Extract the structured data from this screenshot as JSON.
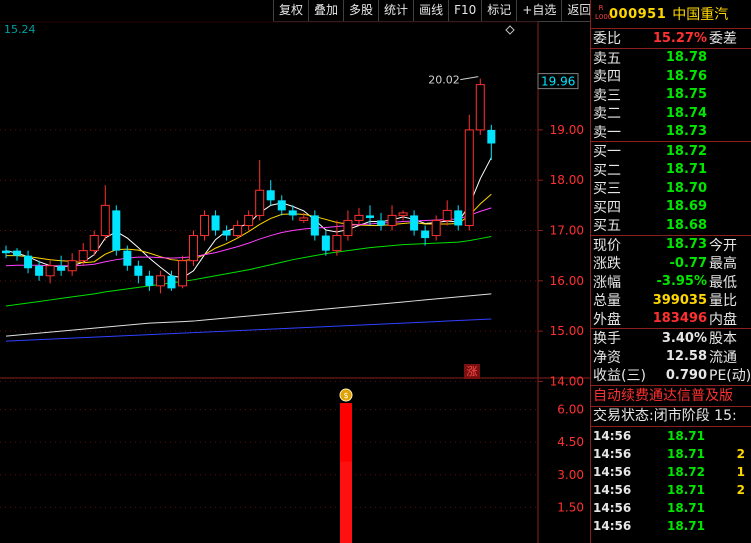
{
  "toolbar": {
    "buttons": [
      "复权",
      "叠加",
      "多股",
      "统计",
      "画线",
      "F10",
      "标记",
      "+自选",
      "返回"
    ]
  },
  "chart": {
    "top_left_value": "15.24",
    "current_price_label": "19.96",
    "high_annotation": "20.02",
    "price_axis_ticks": [
      "19.00",
      "18.00",
      "17.00",
      "16.00",
      "15.00",
      "14.00"
    ],
    "volume_axis_ticks": [
      "6.00",
      "4.50",
      "3.00",
      "1.50"
    ],
    "event_badge": "涨",
    "money_icon": "money-bag-icon"
  },
  "quote": {
    "r_badge": "R\nL000",
    "code": "000951",
    "name": "中国重汽",
    "weibi_label": "委比",
    "weibi_value": "15.27%",
    "weicha_label": "委差",
    "sell": [
      {
        "label": "卖五",
        "price": "18.78"
      },
      {
        "label": "卖四",
        "price": "18.76"
      },
      {
        "label": "卖三",
        "price": "18.75"
      },
      {
        "label": "卖二",
        "price": "18.74"
      },
      {
        "label": "卖一",
        "price": "18.73"
      }
    ],
    "buy": [
      {
        "label": "买一",
        "price": "18.72"
      },
      {
        "label": "买二",
        "price": "18.71"
      },
      {
        "label": "买三",
        "price": "18.70"
      },
      {
        "label": "买四",
        "price": "18.69"
      },
      {
        "label": "买五",
        "price": "18.68"
      }
    ],
    "stats": [
      {
        "label": "现价",
        "value": "18.73",
        "extra": "今开"
      },
      {
        "label": "涨跌",
        "value": "-0.77",
        "extra": "最高"
      },
      {
        "label": "涨幅",
        "value": "-3.95%",
        "extra": "最低"
      },
      {
        "label": "总量",
        "value": "399035",
        "extra": "量比"
      },
      {
        "label": "外盘",
        "value": "183496",
        "extra": "内盘"
      }
    ],
    "stats2": [
      {
        "label": "换手",
        "value": "3.40%",
        "extra": "股本"
      },
      {
        "label": "净资",
        "value": "12.58",
        "extra": "流通"
      },
      {
        "label": "收益(三)",
        "value": "0.790",
        "extra": "PE(动)"
      }
    ],
    "ticker_text": "自动续费通达信普及版",
    "status_text": "交易状态:闭市阶段 15:",
    "trades": [
      {
        "time": "14:56",
        "price": "18.71",
        "vol": ""
      },
      {
        "time": "14:56",
        "price": "18.71",
        "vol": "2"
      },
      {
        "time": "14:56",
        "price": "18.72",
        "vol": "1"
      },
      {
        "time": "14:56",
        "price": "18.71",
        "vol": "2"
      },
      {
        "time": "14:56",
        "price": "18.71",
        "vol": ""
      },
      {
        "time": "14:56",
        "price": "18.71",
        "vol": ""
      }
    ]
  },
  "colors": {
    "up": "#ff3030",
    "down": "#00e5ff",
    "sell_green": "#00e600",
    "gold": "#ffd700",
    "border": "#8a1f1f"
  },
  "chart_data": {
    "type": "candlestick",
    "candles": [
      {
        "o": 16.6,
        "c": 16.55,
        "h": 16.7,
        "l": 16.45
      },
      {
        "o": 16.6,
        "c": 16.5,
        "h": 16.65,
        "l": 16.4
      },
      {
        "o": 16.5,
        "c": 16.25,
        "h": 16.6,
        "l": 16.15
      },
      {
        "o": 16.3,
        "c": 16.1,
        "h": 16.4,
        "l": 16.0
      },
      {
        "o": 16.1,
        "c": 16.3,
        "h": 16.4,
        "l": 15.95
      },
      {
        "o": 16.3,
        "c": 16.2,
        "h": 16.5,
        "l": 16.1
      },
      {
        "o": 16.2,
        "c": 16.4,
        "h": 16.55,
        "l": 16.1
      },
      {
        "o": 16.4,
        "c": 16.6,
        "h": 16.75,
        "l": 16.3
      },
      {
        "o": 16.6,
        "c": 16.9,
        "h": 17.0,
        "l": 16.5
      },
      {
        "o": 16.9,
        "c": 17.5,
        "h": 17.9,
        "l": 16.8
      },
      {
        "o": 17.4,
        "c": 16.6,
        "h": 17.5,
        "l": 16.5
      },
      {
        "o": 16.6,
        "c": 16.3,
        "h": 16.7,
        "l": 16.2
      },
      {
        "o": 16.3,
        "c": 16.1,
        "h": 16.4,
        "l": 15.95
      },
      {
        "o": 16.1,
        "c": 15.9,
        "h": 16.2,
        "l": 15.8
      },
      {
        "o": 15.9,
        "c": 16.1,
        "h": 16.2,
        "l": 15.75
      },
      {
        "o": 16.1,
        "c": 15.85,
        "h": 16.2,
        "l": 15.8
      },
      {
        "o": 15.9,
        "c": 16.4,
        "h": 16.5,
        "l": 15.85
      },
      {
        "o": 16.4,
        "c": 16.9,
        "h": 17.0,
        "l": 16.3
      },
      {
        "o": 16.9,
        "c": 17.3,
        "h": 17.4,
        "l": 16.8
      },
      {
        "o": 17.3,
        "c": 17.0,
        "h": 17.4,
        "l": 16.9
      },
      {
        "o": 17.0,
        "c": 16.9,
        "h": 17.1,
        "l": 16.8
      },
      {
        "o": 16.9,
        "c": 17.1,
        "h": 17.2,
        "l": 16.85
      },
      {
        "o": 17.1,
        "c": 17.3,
        "h": 17.4,
        "l": 17.0
      },
      {
        "o": 17.3,
        "c": 17.8,
        "h": 18.4,
        "l": 17.2
      },
      {
        "o": 17.8,
        "c": 17.6,
        "h": 18.0,
        "l": 17.5
      },
      {
        "o": 17.6,
        "c": 17.4,
        "h": 17.7,
        "l": 17.3
      },
      {
        "o": 17.4,
        "c": 17.3,
        "h": 17.5,
        "l": 17.2
      },
      {
        "o": 17.2,
        "c": 17.25,
        "h": 17.35,
        "l": 17.15
      },
      {
        "o": 17.3,
        "c": 16.9,
        "h": 17.4,
        "l": 16.8
      },
      {
        "o": 16.9,
        "c": 16.6,
        "h": 17.0,
        "l": 16.5
      },
      {
        "o": 16.6,
        "c": 16.9,
        "h": 17.2,
        "l": 16.5
      },
      {
        "o": 16.9,
        "c": 17.2,
        "h": 17.4,
        "l": 16.8
      },
      {
        "o": 17.2,
        "c": 17.3,
        "h": 17.45,
        "l": 17.1
      },
      {
        "o": 17.3,
        "c": 17.25,
        "h": 17.5,
        "l": 17.1
      },
      {
        "o": 17.2,
        "c": 17.1,
        "h": 17.35,
        "l": 17.0
      },
      {
        "o": 17.1,
        "c": 17.3,
        "h": 17.5,
        "l": 17.0
      },
      {
        "o": 17.3,
        "c": 17.35,
        "h": 17.4,
        "l": 17.2
      },
      {
        "o": 17.3,
        "c": 17.0,
        "h": 17.4,
        "l": 16.9
      },
      {
        "o": 17.0,
        "c": 16.85,
        "h": 17.1,
        "l": 16.7
      },
      {
        "o": 16.9,
        "c": 17.2,
        "h": 17.3,
        "l": 16.8
      },
      {
        "o": 17.2,
        "c": 17.4,
        "h": 17.6,
        "l": 17.1
      },
      {
        "o": 17.4,
        "c": 17.1,
        "h": 17.5,
        "l": 17.0
      },
      {
        "o": 17.1,
        "c": 19.0,
        "h": 19.3,
        "l": 17.0
      },
      {
        "o": 19.0,
        "c": 19.9,
        "h": 20.02,
        "l": 18.9
      },
      {
        "o": 19.0,
        "c": 18.73,
        "h": 19.1,
        "l": 18.4
      }
    ],
    "ma_series": [
      {
        "color": "#ffffff",
        "values": [
          16.6,
          16.55,
          16.48,
          16.38,
          16.3,
          16.28,
          16.3,
          16.37,
          16.52,
          16.85,
          16.98,
          16.85,
          16.66,
          16.45,
          16.27,
          16.1,
          16.06,
          16.2,
          16.52,
          16.82,
          16.99,
          17.06,
          17.14,
          17.35,
          17.5,
          17.55,
          17.48,
          17.39,
          17.21,
          17.01,
          16.97,
          17.02,
          17.1,
          17.18,
          17.18,
          17.21,
          17.27,
          17.22,
          17.14,
          17.16,
          17.19,
          17.17,
          17.5,
          18.03,
          18.45
        ]
      },
      {
        "color": "#ffd700",
        "values": [
          16.5,
          16.5,
          16.48,
          16.45,
          16.42,
          16.4,
          16.39,
          16.36,
          16.38,
          16.53,
          16.62,
          16.63,
          16.61,
          16.55,
          16.48,
          16.42,
          16.4,
          16.43,
          16.52,
          16.65,
          16.74,
          16.85,
          16.98,
          17.12,
          17.24,
          17.32,
          17.33,
          17.32,
          17.28,
          17.22,
          17.16,
          17.13,
          17.11,
          17.1,
          17.1,
          17.12,
          17.14,
          17.16,
          17.13,
          17.13,
          17.13,
          17.14,
          17.3,
          17.53,
          17.72
        ]
      },
      {
        "color": "#ff40ff",
        "values": [
          16.3,
          16.31,
          16.31,
          16.31,
          16.3,
          16.3,
          16.3,
          16.31,
          16.33,
          16.38,
          16.42,
          16.45,
          16.47,
          16.47,
          16.46,
          16.45,
          16.46,
          16.48,
          16.52,
          16.56,
          16.62,
          16.68,
          16.75,
          16.83,
          16.9,
          16.96,
          17.0,
          17.03,
          17.05,
          17.06,
          17.08,
          17.1,
          17.12,
          17.13,
          17.15,
          17.16,
          17.18,
          17.19,
          17.2,
          17.21,
          17.22,
          17.23,
          17.3,
          17.38,
          17.45
        ]
      },
      {
        "color": "#00e000",
        "values": [
          15.5,
          15.53,
          15.56,
          15.59,
          15.62,
          15.65,
          15.68,
          15.71,
          15.74,
          15.78,
          15.81,
          15.84,
          15.87,
          15.9,
          15.93,
          15.96,
          15.99,
          16.02,
          16.06,
          16.1,
          16.14,
          16.18,
          16.22,
          16.27,
          16.32,
          16.37,
          16.42,
          16.46,
          16.5,
          16.54,
          16.57,
          16.6,
          16.63,
          16.66,
          16.68,
          16.7,
          16.72,
          16.73,
          16.74,
          16.75,
          16.76,
          16.77,
          16.8,
          16.84,
          16.88
        ]
      },
      {
        "color": "#e0e0e0",
        "values": [
          14.9,
          14.92,
          14.94,
          14.96,
          14.98,
          15.0,
          15.02,
          15.04,
          15.06,
          15.08,
          15.1,
          15.12,
          15.14,
          15.16,
          15.17,
          15.18,
          15.19,
          15.2,
          15.22,
          15.24,
          15.26,
          15.28,
          15.3,
          15.32,
          15.34,
          15.36,
          15.38,
          15.4,
          15.42,
          15.44,
          15.46,
          15.48,
          15.5,
          15.52,
          15.54,
          15.56,
          15.58,
          15.6,
          15.62,
          15.64,
          15.66,
          15.68,
          15.7,
          15.72,
          15.74
        ]
      },
      {
        "color": "#3040ff",
        "values": [
          14.8,
          14.81,
          14.82,
          14.83,
          14.84,
          14.85,
          14.86,
          14.87,
          14.88,
          14.89,
          14.9,
          14.91,
          14.92,
          14.93,
          14.94,
          14.95,
          14.96,
          14.97,
          14.98,
          14.99,
          15.0,
          15.01,
          15.02,
          15.03,
          15.04,
          15.05,
          15.06,
          15.07,
          15.08,
          15.09,
          15.1,
          15.11,
          15.12,
          15.13,
          15.14,
          15.15,
          15.16,
          15.17,
          15.18,
          15.19,
          15.2,
          15.21,
          15.22,
          15.23,
          15.24
        ]
      }
    ],
    "price_ylim": [
      13.75,
      20.35
    ],
    "volume_bar": {
      "index": 30,
      "total": 6.3,
      "inner": 3.6
    },
    "volume_ylim": [
      0,
      6.9
    ]
  }
}
